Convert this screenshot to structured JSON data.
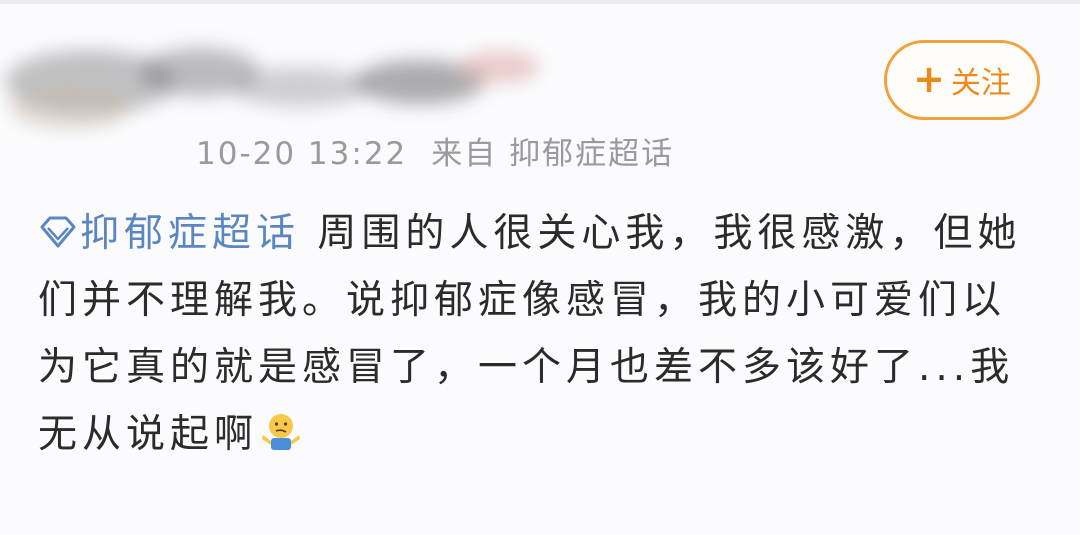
{
  "header": {
    "follow_label": "关注",
    "follow_plus": "+",
    "follow_color": "#f0a33c"
  },
  "meta": {
    "timestamp": "10-20 13:22",
    "source_prefix": "来自",
    "source_name": "抑郁症超话"
  },
  "post": {
    "topic_label": "抑郁症超话",
    "topic_icon": "diamond-icon",
    "topic_color": "#5a87c2",
    "text": "周围的人很关心我，我很感激，但她们并不理解我。说抑郁症像感冒，我的小可爱们以为它真的就是感冒了，一个月也差不多该好了...我无从说起啊",
    "emoji": "shrug-emoji"
  }
}
